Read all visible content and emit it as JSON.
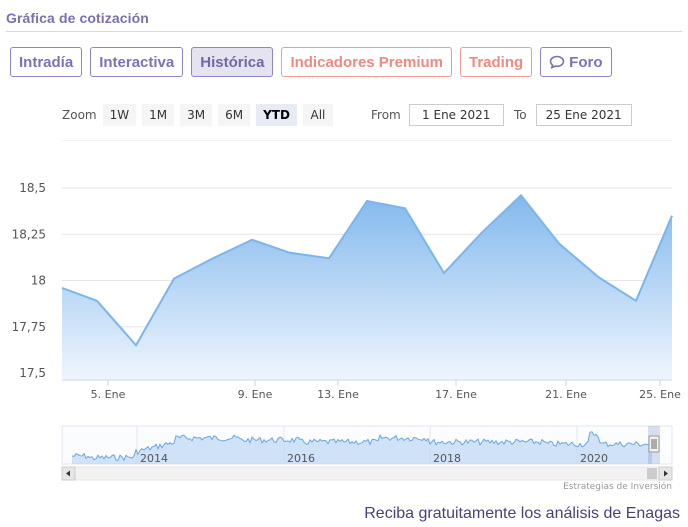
{
  "header": {
    "title": "Gráfica de cotización"
  },
  "tabs": [
    {
      "label": "Intradía",
      "active": false,
      "premium": false,
      "icon": ""
    },
    {
      "label": "Interactiva",
      "active": false,
      "premium": false,
      "icon": ""
    },
    {
      "label": "Histórica",
      "active": true,
      "premium": false,
      "icon": ""
    },
    {
      "label": "Indicadores Premium",
      "active": false,
      "premium": true,
      "icon": ""
    },
    {
      "label": "Trading",
      "active": false,
      "premium": true,
      "icon": ""
    },
    {
      "label": "Foro",
      "active": false,
      "premium": false,
      "icon": "chat-bubble-icon"
    }
  ],
  "zoom": {
    "label": "Zoom",
    "buttons": [
      "1W",
      "1M",
      "3M",
      "6M",
      "YTD",
      "All"
    ],
    "selected": "YTD"
  },
  "range": {
    "from_label": "From",
    "from_value": "1 Ene 2021",
    "to_label": "To",
    "to_value": "25 Ene 2021"
  },
  "colors": {
    "accent": "#7a6fb0",
    "premium": "#ef8a82",
    "series_line": "#7cb5ec",
    "area_top": "#7cb5ec",
    "area_bottom": "#eef5fd"
  },
  "chart_data": {
    "type": "area",
    "title": "",
    "xlabel": "",
    "ylabel": "",
    "x": [
      "4 Ene",
      "5 Ene",
      "6 Ene",
      "7 Ene",
      "8 Ene",
      "9 Ene",
      "10 Ene",
      "11 Ene",
      "12 Ene",
      "13 Ene",
      "14 Ene",
      "15 Ene",
      "16 Ene",
      "17 Ene",
      "18 Ene",
      "19 Ene",
      "20 Ene",
      "21 Ene",
      "22 Ene",
      "23 Ene",
      "24 Ene",
      "25 Ene"
    ],
    "series": [
      {
        "values": [
          17.96,
          17.89,
          17.65,
          18.01,
          18.12,
          18.22,
          18.15,
          18.12,
          18.43,
          18.39,
          18.04,
          18.26,
          18.46,
          18.2,
          18.02,
          17.89,
          18.35
        ]
      }
    ],
    "x_tick_labels": [
      "5. Ene",
      "9. Ene",
      "13. Ene",
      "17. Ene",
      "21. Ene",
      "25. Ene"
    ],
    "y_tick_labels": [
      "17,5",
      "17,75",
      "18",
      "18,25",
      "18,5"
    ],
    "ylim": [
      17.5,
      18.5
    ],
    "y_ticks": [
      17.5,
      17.75,
      18,
      18.25,
      18.5
    ],
    "grid": true,
    "legend": "none"
  },
  "navigator": {
    "year_labels": [
      "2014",
      "2016",
      "2018",
      "2020"
    ],
    "credit": "Estrategias de Inversión"
  },
  "footer": {
    "cta": "Reciba gratuitamente los análisis de Enagas"
  }
}
